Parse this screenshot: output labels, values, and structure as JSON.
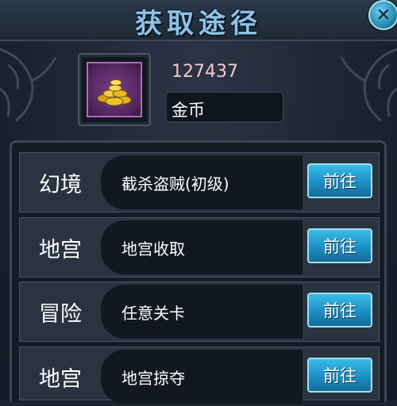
{
  "title": "获取途径",
  "item": {
    "icon": "gold-coins-icon",
    "count": "127437",
    "name": "金币"
  },
  "sources": [
    {
      "category": "幻境",
      "description": "截杀盗贼(初级)",
      "button": "前往"
    },
    {
      "category": "地宫",
      "description": "地宫收取",
      "button": "前往"
    },
    {
      "category": "冒险",
      "description": "任意关卡",
      "button": "前往"
    },
    {
      "category": "地宫",
      "description": "地宫掠夺",
      "button": "前往"
    }
  ],
  "colors": {
    "title": "#8fc2e6",
    "count": "#f2c9cf",
    "button": "#1e8fc4",
    "item_bg": "#532660"
  }
}
